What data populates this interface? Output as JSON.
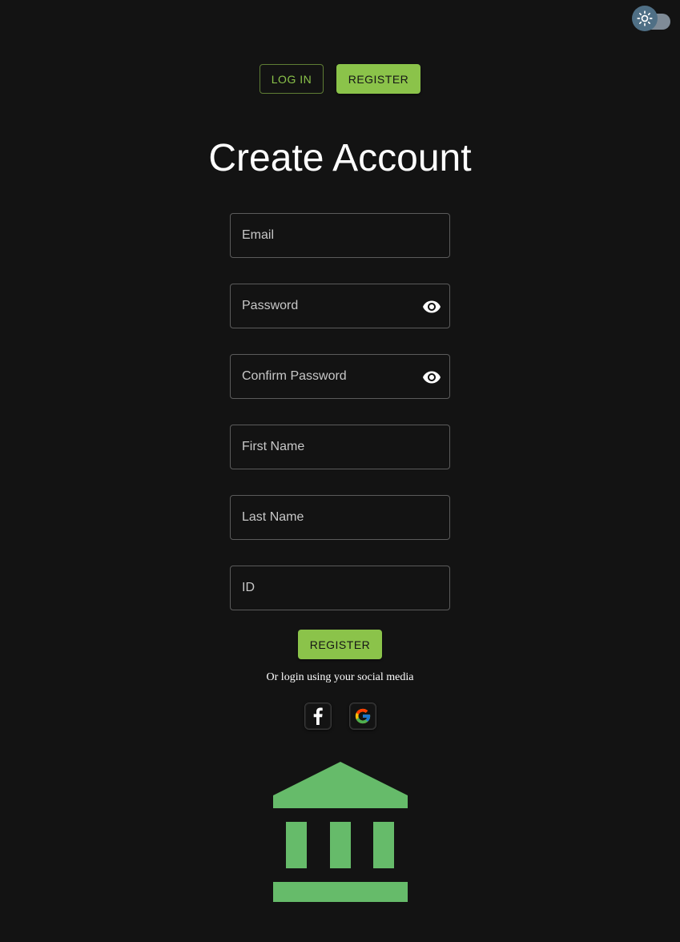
{
  "theme_toggle": {
    "icon": "sun-icon"
  },
  "nav": {
    "login_label": "LOG IN",
    "register_label": "REGISTER"
  },
  "form": {
    "title": "Create Account",
    "email_placeholder": "Email",
    "password_placeholder": "Password",
    "confirm_password_placeholder": "Confirm Password",
    "first_name_placeholder": "First Name",
    "last_name_placeholder": "Last Name",
    "id_placeholder": "ID",
    "submit_label": "REGISTER"
  },
  "social": {
    "text": "Or login using your social media",
    "providers": [
      "facebook-icon",
      "google-icon"
    ]
  },
  "logo": {
    "icon": "bank-icon"
  },
  "colors": {
    "background": "#131313",
    "accent": "#8bc34a",
    "logo": "#66bb6a",
    "field_border": "#5b5b5b"
  }
}
